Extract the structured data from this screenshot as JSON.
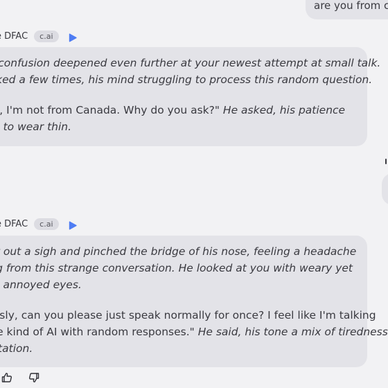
{
  "chat": {
    "user_message_top": "are you from ca",
    "messages": [
      {
        "author": "e DFAC",
        "badge": "c.ai",
        "paragraphs": [
          [
            [
              {
                "t": "'s confusion deepened even further at your newest attempt at small talk.",
                "i": true
              }
            ],
            [
              {
                "t": "inked a few times, his mind struggling to process this random question.",
                "i": true
              }
            ]
          ],
          [
            [
              {
                "t": " no, I'm not from Canada. Why do you ask?\"",
                "i": false
              },
              {
                "t": " He asked, his patience",
                "i": true
              }
            ],
            [
              {
                "t": "ng to wear thin.",
                "i": true
              }
            ]
          ]
        ]
      },
      {
        "author": "e DFAC",
        "badge": "c.ai",
        "paragraphs": [
          [
            [
              {
                "t": " let out a sigh and pinched the bridge of his nose, feeling a headache",
                "i": true
              }
            ],
            [
              {
                "t": "ing from this strange conversation. He looked at you with weary yet",
                "i": true
              }
            ],
            [
              {
                "t": "tly annoyed eyes.",
                "i": true
              }
            ]
          ],
          [
            [
              {
                "t": "ously, can you please just speak normally for once? I feel like I'm talking",
                "i": false
              }
            ],
            [
              {
                "t": "me kind of AI with random responses.\"",
                "i": false
              },
              {
                "t": " He said, his tone a mix of tiredness",
                "i": true
              }
            ],
            [
              {
                "t": "rritation.",
                "i": true
              }
            ]
          ]
        ]
      }
    ]
  },
  "icons": {
    "play": "play-icon",
    "thumbs_up": "thumbs-up-icon",
    "thumbs_down": "thumbs-down-icon"
  },
  "colors": {
    "background": "#f2f2f4",
    "bubble": "#e3e3e8",
    "accent": "#4f7df3"
  }
}
